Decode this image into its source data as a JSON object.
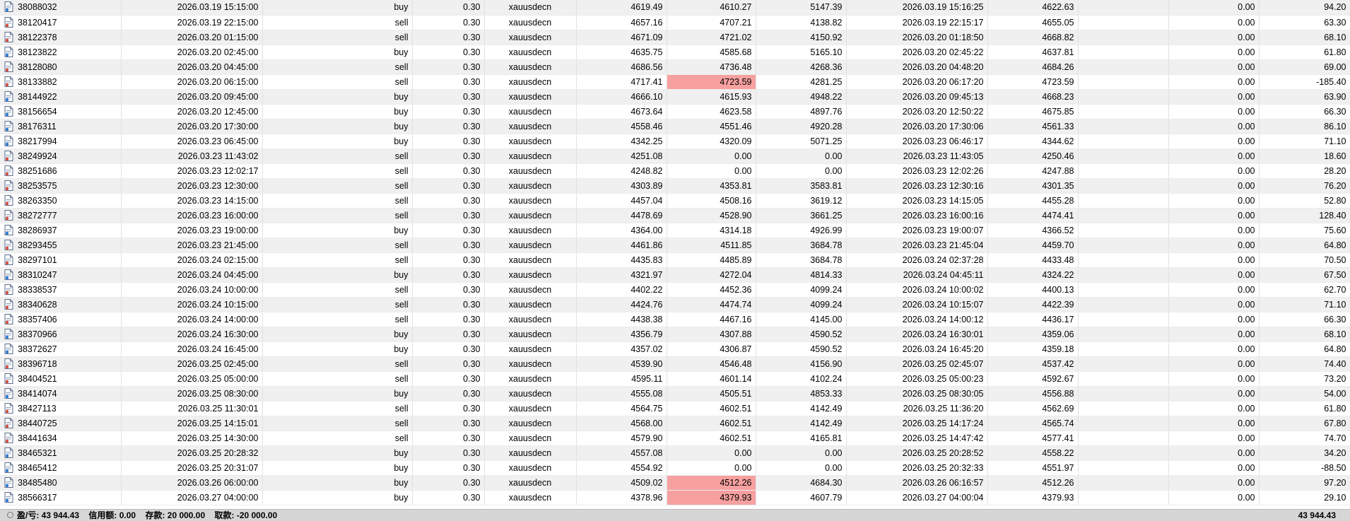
{
  "colors": {
    "loss_highlight": "#f7a0a0",
    "row_alt": "#f0f0f0",
    "status_bar": "#d6d6d6"
  },
  "icons": {
    "row": "ticket-doc-icon",
    "status": "balance-circle-icon"
  },
  "rows": [
    {
      "ticket": "38088032",
      "open_time": "2026.03.19 15:15:00",
      "type": "buy",
      "volume": "0.30",
      "symbol": "xauusdecn",
      "open_price": "4619.49",
      "sl": "4610.27",
      "tp": "5147.39",
      "close_time": "2026.03.19 15:16:25",
      "close_price": "4622.63",
      "swap": "0.00",
      "profit": "94.20",
      "sl_hit": false
    },
    {
      "ticket": "38120417",
      "open_time": "2026.03.19 22:15:00",
      "type": "sell",
      "volume": "0.30",
      "symbol": "xauusdecn",
      "open_price": "4657.16",
      "sl": "4707.21",
      "tp": "4138.82",
      "close_time": "2026.03.19 22:15:17",
      "close_price": "4655.05",
      "swap": "0.00",
      "profit": "63.30",
      "sl_hit": false
    },
    {
      "ticket": "38122378",
      "open_time": "2026.03.20 01:15:00",
      "type": "sell",
      "volume": "0.30",
      "symbol": "xauusdecn",
      "open_price": "4671.09",
      "sl": "4721.02",
      "tp": "4150.92",
      "close_time": "2026.03.20 01:18:50",
      "close_price": "4668.82",
      "swap": "0.00",
      "profit": "68.10",
      "sl_hit": false
    },
    {
      "ticket": "38123822",
      "open_time": "2026.03.20 02:45:00",
      "type": "buy",
      "volume": "0.30",
      "symbol": "xauusdecn",
      "open_price": "4635.75",
      "sl": "4585.68",
      "tp": "5165.10",
      "close_time": "2026.03.20 02:45:22",
      "close_price": "4637.81",
      "swap": "0.00",
      "profit": "61.80",
      "sl_hit": false
    },
    {
      "ticket": "38128080",
      "open_time": "2026.03.20 04:45:00",
      "type": "sell",
      "volume": "0.30",
      "symbol": "xauusdecn",
      "open_price": "4686.56",
      "sl": "4736.48",
      "tp": "4268.36",
      "close_time": "2026.03.20 04:48:20",
      "close_price": "4684.26",
      "swap": "0.00",
      "profit": "69.00",
      "sl_hit": false
    },
    {
      "ticket": "38133882",
      "open_time": "2026.03.20 06:15:00",
      "type": "sell",
      "volume": "0.30",
      "symbol": "xauusdecn",
      "open_price": "4717.41",
      "sl": "4723.59",
      "tp": "4281.25",
      "close_time": "2026.03.20 06:17:20",
      "close_price": "4723.59",
      "swap": "0.00",
      "profit": "-185.40",
      "sl_hit": true
    },
    {
      "ticket": "38144922",
      "open_time": "2026.03.20 09:45:00",
      "type": "buy",
      "volume": "0.30",
      "symbol": "xauusdecn",
      "open_price": "4666.10",
      "sl": "4615.93",
      "tp": "4948.22",
      "close_time": "2026.03.20 09:45:13",
      "close_price": "4668.23",
      "swap": "0.00",
      "profit": "63.90",
      "sl_hit": false
    },
    {
      "ticket": "38156654",
      "open_time": "2026.03.20 12:45:00",
      "type": "buy",
      "volume": "0.30",
      "symbol": "xauusdecn",
      "open_price": "4673.64",
      "sl": "4623.58",
      "tp": "4897.76",
      "close_time": "2026.03.20 12:50:22",
      "close_price": "4675.85",
      "swap": "0.00",
      "profit": "66.30",
      "sl_hit": false
    },
    {
      "ticket": "38176311",
      "open_time": "2026.03.20 17:30:00",
      "type": "buy",
      "volume": "0.30",
      "symbol": "xauusdecn",
      "open_price": "4558.46",
      "sl": "4551.46",
      "tp": "4920.28",
      "close_time": "2026.03.20 17:30:06",
      "close_price": "4561.33",
      "swap": "0.00",
      "profit": "86.10",
      "sl_hit": false
    },
    {
      "ticket": "38217994",
      "open_time": "2026.03.23 06:45:00",
      "type": "buy",
      "volume": "0.30",
      "symbol": "xauusdecn",
      "open_price": "4342.25",
      "sl": "4320.09",
      "tp": "5071.25",
      "close_time": "2026.03.23 06:46:17",
      "close_price": "4344.62",
      "swap": "0.00",
      "profit": "71.10",
      "sl_hit": false
    },
    {
      "ticket": "38249924",
      "open_time": "2026.03.23 11:43:02",
      "type": "sell",
      "volume": "0.30",
      "symbol": "xauusdecn",
      "open_price": "4251.08",
      "sl": "0.00",
      "tp": "0.00",
      "close_time": "2026.03.23 11:43:05",
      "close_price": "4250.46",
      "swap": "0.00",
      "profit": "18.60",
      "sl_hit": false
    },
    {
      "ticket": "38251686",
      "open_time": "2026.03.23 12:02:17",
      "type": "sell",
      "volume": "0.30",
      "symbol": "xauusdecn",
      "open_price": "4248.82",
      "sl": "0.00",
      "tp": "0.00",
      "close_time": "2026.03.23 12:02:26",
      "close_price": "4247.88",
      "swap": "0.00",
      "profit": "28.20",
      "sl_hit": false
    },
    {
      "ticket": "38253575",
      "open_time": "2026.03.23 12:30:00",
      "type": "sell",
      "volume": "0.30",
      "symbol": "xauusdecn",
      "open_price": "4303.89",
      "sl": "4353.81",
      "tp": "3583.81",
      "close_time": "2026.03.23 12:30:16",
      "close_price": "4301.35",
      "swap": "0.00",
      "profit": "76.20",
      "sl_hit": false
    },
    {
      "ticket": "38263350",
      "open_time": "2026.03.23 14:15:00",
      "type": "sell",
      "volume": "0.30",
      "symbol": "xauusdecn",
      "open_price": "4457.04",
      "sl": "4508.16",
      "tp": "3619.12",
      "close_time": "2026.03.23 14:15:05",
      "close_price": "4455.28",
      "swap": "0.00",
      "profit": "52.80",
      "sl_hit": false
    },
    {
      "ticket": "38272777",
      "open_time": "2026.03.23 16:00:00",
      "type": "sell",
      "volume": "0.30",
      "symbol": "xauusdecn",
      "open_price": "4478.69",
      "sl": "4528.90",
      "tp": "3661.25",
      "close_time": "2026.03.23 16:00:16",
      "close_price": "4474.41",
      "swap": "0.00",
      "profit": "128.40",
      "sl_hit": false
    },
    {
      "ticket": "38286937",
      "open_time": "2026.03.23 19:00:00",
      "type": "buy",
      "volume": "0.30",
      "symbol": "xauusdecn",
      "open_price": "4364.00",
      "sl": "4314.18",
      "tp": "4926.99",
      "close_time": "2026.03.23 19:00:07",
      "close_price": "4366.52",
      "swap": "0.00",
      "profit": "75.60",
      "sl_hit": false
    },
    {
      "ticket": "38293455",
      "open_time": "2026.03.23 21:45:00",
      "type": "sell",
      "volume": "0.30",
      "symbol": "xauusdecn",
      "open_price": "4461.86",
      "sl": "4511.85",
      "tp": "3684.78",
      "close_time": "2026.03.23 21:45:04",
      "close_price": "4459.70",
      "swap": "0.00",
      "profit": "64.80",
      "sl_hit": false
    },
    {
      "ticket": "38297101",
      "open_time": "2026.03.24 02:15:00",
      "type": "sell",
      "volume": "0.30",
      "symbol": "xauusdecn",
      "open_price": "4435.83",
      "sl": "4485.89",
      "tp": "3684.78",
      "close_time": "2026.03.24 02:37:28",
      "close_price": "4433.48",
      "swap": "0.00",
      "profit": "70.50",
      "sl_hit": false
    },
    {
      "ticket": "38310247",
      "open_time": "2026.03.24 04:45:00",
      "type": "buy",
      "volume": "0.30",
      "symbol": "xauusdecn",
      "open_price": "4321.97",
      "sl": "4272.04",
      "tp": "4814.33",
      "close_time": "2026.03.24 04:45:11",
      "close_price": "4324.22",
      "swap": "0.00",
      "profit": "67.50",
      "sl_hit": false
    },
    {
      "ticket": "38338537",
      "open_time": "2026.03.24 10:00:00",
      "type": "sell",
      "volume": "0.30",
      "symbol": "xauusdecn",
      "open_price": "4402.22",
      "sl": "4452.36",
      "tp": "4099.24",
      "close_time": "2026.03.24 10:00:02",
      "close_price": "4400.13",
      "swap": "0.00",
      "profit": "62.70",
      "sl_hit": false
    },
    {
      "ticket": "38340628",
      "open_time": "2026.03.24 10:15:00",
      "type": "sell",
      "volume": "0.30",
      "symbol": "xauusdecn",
      "open_price": "4424.76",
      "sl": "4474.74",
      "tp": "4099.24",
      "close_time": "2026.03.24 10:15:07",
      "close_price": "4422.39",
      "swap": "0.00",
      "profit": "71.10",
      "sl_hit": false
    },
    {
      "ticket": "38357406",
      "open_time": "2026.03.24 14:00:00",
      "type": "sell",
      "volume": "0.30",
      "symbol": "xauusdecn",
      "open_price": "4438.38",
      "sl": "4467.16",
      "tp": "4145.00",
      "close_time": "2026.03.24 14:00:12",
      "close_price": "4436.17",
      "swap": "0.00",
      "profit": "66.30",
      "sl_hit": false
    },
    {
      "ticket": "38370966",
      "open_time": "2026.03.24 16:30:00",
      "type": "buy",
      "volume": "0.30",
      "symbol": "xauusdecn",
      "open_price": "4356.79",
      "sl": "4307.88",
      "tp": "4590.52",
      "close_time": "2026.03.24 16:30:01",
      "close_price": "4359.06",
      "swap": "0.00",
      "profit": "68.10",
      "sl_hit": false
    },
    {
      "ticket": "38372627",
      "open_time": "2026.03.24 16:45:00",
      "type": "buy",
      "volume": "0.30",
      "symbol": "xauusdecn",
      "open_price": "4357.02",
      "sl": "4306.87",
      "tp": "4590.52",
      "close_time": "2026.03.24 16:45:20",
      "close_price": "4359.18",
      "swap": "0.00",
      "profit": "64.80",
      "sl_hit": false
    },
    {
      "ticket": "38396718",
      "open_time": "2026.03.25 02:45:00",
      "type": "sell",
      "volume": "0.30",
      "symbol": "xauusdecn",
      "open_price": "4539.90",
      "sl": "4546.48",
      "tp": "4156.90",
      "close_time": "2026.03.25 02:45:07",
      "close_price": "4537.42",
      "swap": "0.00",
      "profit": "74.40",
      "sl_hit": false
    },
    {
      "ticket": "38404521",
      "open_time": "2026.03.25 05:00:00",
      "type": "sell",
      "volume": "0.30",
      "symbol": "xauusdecn",
      "open_price": "4595.11",
      "sl": "4601.14",
      "tp": "4102.24",
      "close_time": "2026.03.25 05:00:23",
      "close_price": "4592.67",
      "swap": "0.00",
      "profit": "73.20",
      "sl_hit": false
    },
    {
      "ticket": "38414074",
      "open_time": "2026.03.25 08:30:00",
      "type": "buy",
      "volume": "0.30",
      "symbol": "xauusdecn",
      "open_price": "4555.08",
      "sl": "4505.51",
      "tp": "4853.33",
      "close_time": "2026.03.25 08:30:05",
      "close_price": "4556.88",
      "swap": "0.00",
      "profit": "54.00",
      "sl_hit": false
    },
    {
      "ticket": "38427113",
      "open_time": "2026.03.25 11:30:01",
      "type": "sell",
      "volume": "0.30",
      "symbol": "xauusdecn",
      "open_price": "4564.75",
      "sl": "4602.51",
      "tp": "4142.49",
      "close_time": "2026.03.25 11:36:20",
      "close_price": "4562.69",
      "swap": "0.00",
      "profit": "61.80",
      "sl_hit": false
    },
    {
      "ticket": "38440725",
      "open_time": "2026.03.25 14:15:01",
      "type": "sell",
      "volume": "0.30",
      "symbol": "xauusdecn",
      "open_price": "4568.00",
      "sl": "4602.51",
      "tp": "4142.49",
      "close_time": "2026.03.25 14:17:24",
      "close_price": "4565.74",
      "swap": "0.00",
      "profit": "67.80",
      "sl_hit": false
    },
    {
      "ticket": "38441634",
      "open_time": "2026.03.25 14:30:00",
      "type": "sell",
      "volume": "0.30",
      "symbol": "xauusdecn",
      "open_price": "4579.90",
      "sl": "4602.51",
      "tp": "4165.81",
      "close_time": "2026.03.25 14:47:42",
      "close_price": "4577.41",
      "swap": "0.00",
      "profit": "74.70",
      "sl_hit": false
    },
    {
      "ticket": "38465321",
      "open_time": "2026.03.25 20:28:32",
      "type": "buy",
      "volume": "0.30",
      "symbol": "xauusdecn",
      "open_price": "4557.08",
      "sl": "0.00",
      "tp": "0.00",
      "close_time": "2026.03.25 20:28:52",
      "close_price": "4558.22",
      "swap": "0.00",
      "profit": "34.20",
      "sl_hit": false
    },
    {
      "ticket": "38465412",
      "open_time": "2026.03.25 20:31:07",
      "type": "buy",
      "volume": "0.30",
      "symbol": "xauusdecn",
      "open_price": "4554.92",
      "sl": "0.00",
      "tp": "0.00",
      "close_time": "2026.03.25 20:32:33",
      "close_price": "4551.97",
      "swap": "0.00",
      "profit": "-88.50",
      "sl_hit": false
    },
    {
      "ticket": "38485480",
      "open_time": "2026.03.26 06:00:00",
      "type": "buy",
      "volume": "0.30",
      "symbol": "xauusdecn",
      "open_price": "4509.02",
      "sl": "4512.26",
      "tp": "4684.30",
      "close_time": "2026.03.26 06:16:57",
      "close_price": "4512.26",
      "swap": "0.00",
      "profit": "97.20",
      "sl_hit": true
    },
    {
      "ticket": "38566317",
      "open_time": "2026.03.27 04:00:00",
      "type": "buy",
      "volume": "0.30",
      "symbol": "xauusdecn",
      "open_price": "4378.96",
      "sl": "4379.93",
      "tp": "4607.79",
      "close_time": "2026.03.27 04:00:04",
      "close_price": "4379.93",
      "swap": "0.00",
      "profit": "29.10",
      "sl_hit": true
    }
  ],
  "status": {
    "profit": "盈/亏: 43 944.43",
    "credit": "信用额: 0.00",
    "deposit": "存款: 20 000.00",
    "withdrawal": "取款: -20 000.00",
    "total": "43 944.43"
  }
}
